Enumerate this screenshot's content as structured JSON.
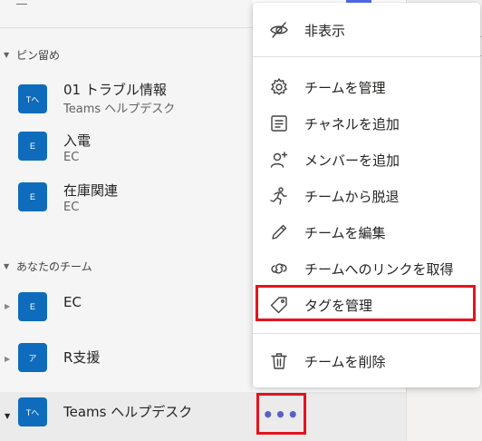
{
  "top_fragment": "―",
  "sidebar": {
    "pinned_header": "ピン留め",
    "pinned": [
      {
        "avatar": "Tへ",
        "name": "01 トラブル情報",
        "sub": "Teams ヘルプデスク"
      },
      {
        "avatar": "E",
        "name": "入電",
        "sub": "EC"
      },
      {
        "avatar": "E",
        "name": "在庫関連",
        "sub": "EC"
      }
    ],
    "teams_header": "あなたのチーム",
    "teams": [
      {
        "avatar": "E",
        "name": "EC"
      },
      {
        "avatar": "ア",
        "name": "R支援"
      },
      {
        "avatar": "Tへ",
        "name": "Teams ヘルプデスク"
      }
    ]
  },
  "menu": {
    "items": [
      {
        "icon": "eye-off-icon",
        "label": "非表示"
      },
      {
        "icon": "gear-icon",
        "label": "チームを管理"
      },
      {
        "icon": "channel-list-icon",
        "label": "チャネルを追加"
      },
      {
        "icon": "person-add-icon",
        "label": "メンバーを追加"
      },
      {
        "icon": "leave-running-icon",
        "label": "チームから脱退"
      },
      {
        "icon": "pencil-icon",
        "label": "チームを編集"
      },
      {
        "icon": "link-icon",
        "label": "チームへのリンクを取得"
      },
      {
        "icon": "tag-icon",
        "label": "タグを管理"
      },
      {
        "icon": "trash-icon",
        "label": "チームを削除"
      }
    ]
  },
  "more_button": "•••",
  "colors": {
    "accent": "#5b5fc7",
    "avatar": "#0f6cbd",
    "highlight": "#e4141e"
  }
}
